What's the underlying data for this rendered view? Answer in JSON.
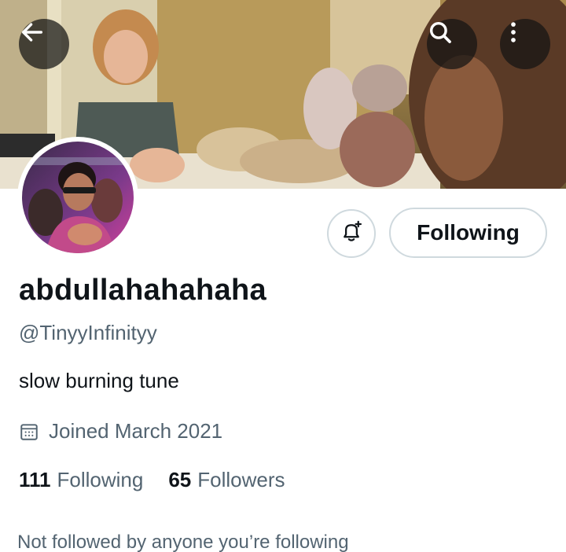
{
  "header": {
    "back_icon": "arrow-left-icon",
    "search_icon": "search-icon",
    "more_icon": "more-vertical-icon"
  },
  "profile": {
    "display_name": "abdullahahahaha",
    "handle": "@TinyyInfinityy",
    "bio": "slow burning tune",
    "joined": "Joined March 2021",
    "following_count": "111",
    "following_label": "Following",
    "followers_count": "65",
    "followers_label": "Followers",
    "follow_notice": "Not followed by anyone you’re following"
  },
  "actions": {
    "notify_icon": "bell-plus-icon",
    "follow_button_label": "Following"
  },
  "colors": {
    "text_primary": "#0f1419",
    "text_secondary": "#536471",
    "border": "#cfd9de"
  }
}
